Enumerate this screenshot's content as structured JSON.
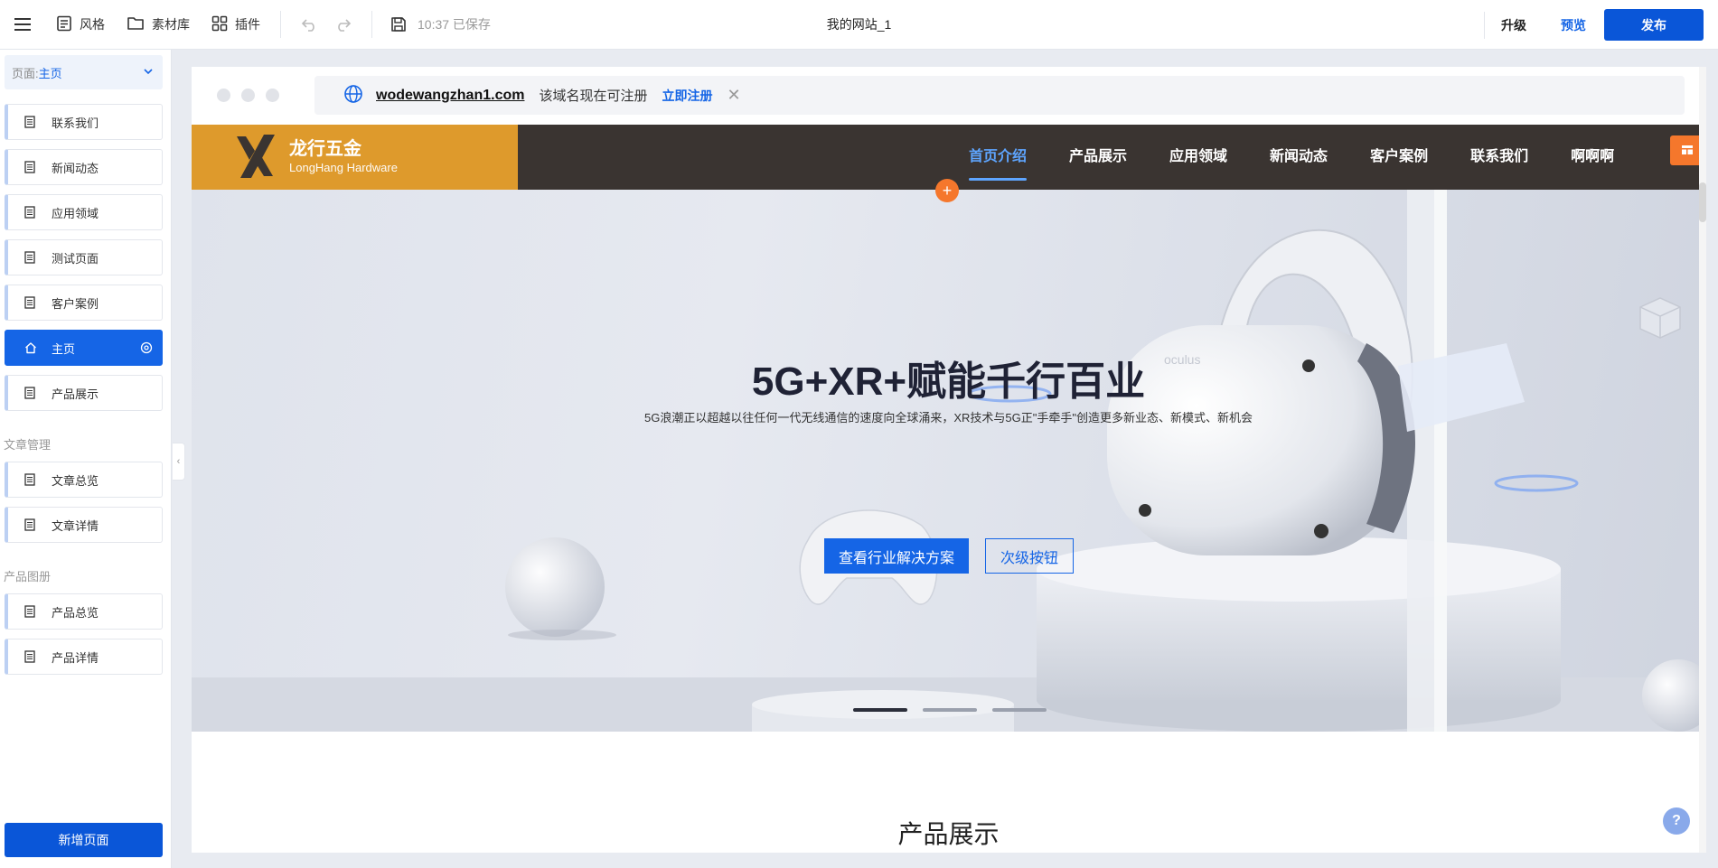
{
  "toolbar": {
    "style_label": "风格",
    "assets_label": "素材库",
    "plugins_label": "插件",
    "saved_status": "10:37 已保存",
    "site_title": "我的网站_1",
    "upgrade_label": "升级",
    "preview_label": "预览",
    "publish_label": "发布"
  },
  "sidebar": {
    "page_select_prefix": "页面:",
    "page_select_value": "主页",
    "pages": [
      {
        "label": "联系我们",
        "active": false
      },
      {
        "label": "新闻动态",
        "active": false
      },
      {
        "label": "应用领域",
        "active": false
      },
      {
        "label": "测试页面",
        "active": false
      },
      {
        "label": "客户案例",
        "active": false
      },
      {
        "label": "主页",
        "active": true
      },
      {
        "label": "产品展示",
        "active": false
      }
    ],
    "article_section": "文章管理",
    "article_pages": [
      {
        "label": "文章总览"
      },
      {
        "label": "文章详情"
      }
    ],
    "product_section": "产品图册",
    "product_pages": [
      {
        "label": "产品总览"
      },
      {
        "label": "产品详情"
      }
    ],
    "new_page_label": "新增页面"
  },
  "browser": {
    "domain": "wodewangzhan1.com",
    "note": "该域名现在可注册",
    "register_label": "立即注册"
  },
  "site": {
    "logo_cn": "龙行五金",
    "logo_en": "LongHang Hardware",
    "nav": [
      "首页介绍",
      "产品展示",
      "应用领域",
      "新闻动态",
      "客户案例",
      "联系我们",
      "啊啊啊"
    ],
    "hero_title": "5G+XR+赋能千行百业",
    "hero_subtitle": "5G浪潮正以超越以往任何一代无线通信的速度向全球涌来，XR技术与5G正\"手牵手\"创造更多新业态、新模式、新机会",
    "hero_primary_btn": "查看行业解决方案",
    "hero_secondary_btn": "次级按钮",
    "hero_image_text": "oculus",
    "slide_count": 3,
    "active_slide": 1,
    "section_title": "产品展示"
  },
  "help_label": "?",
  "colors": {
    "accent": "#1565e6",
    "publish": "#0a56d8",
    "logo_bg": "#de9a2c",
    "header_bg": "#3a3431",
    "orange": "#f5772c"
  }
}
